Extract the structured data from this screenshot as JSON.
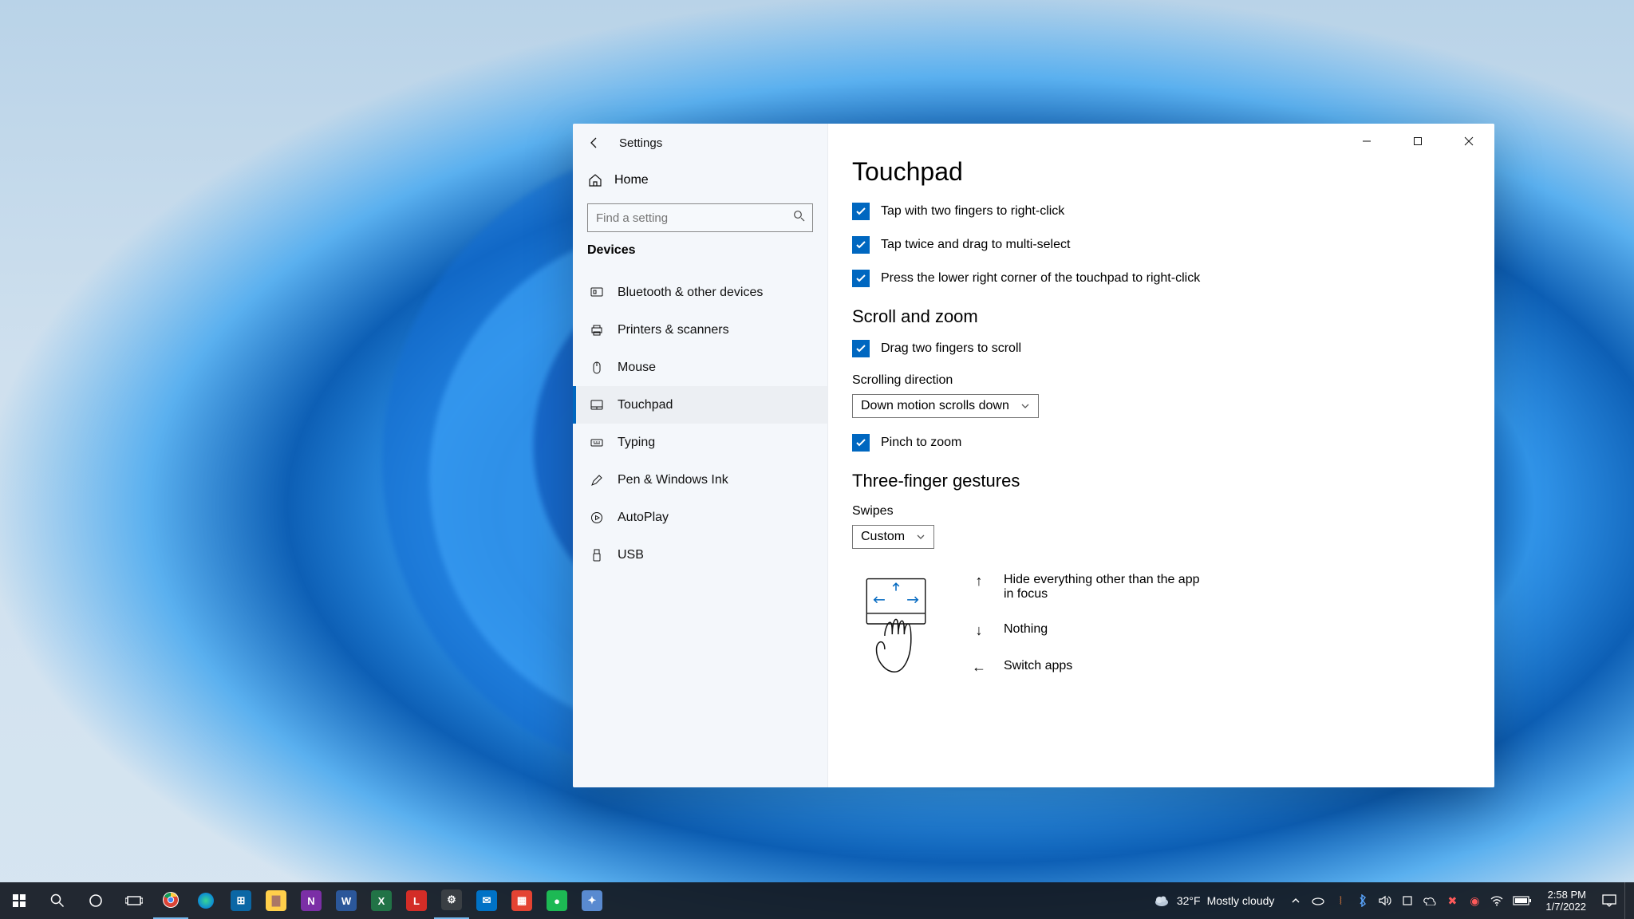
{
  "window": {
    "title": "Settings",
    "home": "Home",
    "search_placeholder": "Find a setting",
    "category": "Devices"
  },
  "sidebar": {
    "items": [
      {
        "label": "Bluetooth & other devices"
      },
      {
        "label": "Printers & scanners"
      },
      {
        "label": "Mouse"
      },
      {
        "label": "Touchpad"
      },
      {
        "label": "Typing"
      },
      {
        "label": "Pen & Windows Ink"
      },
      {
        "label": "AutoPlay"
      },
      {
        "label": "USB"
      }
    ]
  },
  "page": {
    "title": "Touchpad",
    "taps": [
      "Tap with two fingers to right-click",
      "Tap twice and drag to multi-select",
      "Press the lower right corner of the touchpad to right-click"
    ],
    "scroll_zoom_h": "Scroll and zoom",
    "drag_two": "Drag two fingers to scroll",
    "scroll_dir_label": "Scrolling direction",
    "scroll_dir_value": "Down motion scrolls down",
    "pinch": "Pinch to zoom",
    "three_h": "Three-finger gestures",
    "swipes_label": "Swipes",
    "swipes_value": "Custom",
    "gestures": {
      "up": "Hide everything other than the app in focus",
      "down": "Nothing",
      "left": "Switch apps"
    }
  },
  "taskbar": {
    "weather_temp": "32°F",
    "weather_text": "Mostly cloudy",
    "time": "2:58 PM",
    "date": "1/7/2022",
    "apps": [
      {
        "name": "chrome",
        "bg": "#fff",
        "fg": "#db4437",
        "letter": "◎"
      },
      {
        "name": "edge",
        "bg": "#0b8ad6",
        "fg": "#0b8",
        "letter": ""
      },
      {
        "name": "store",
        "bg": "#0b67a5",
        "fg": "#fff",
        "letter": "⊞"
      },
      {
        "name": "explorer",
        "bg": "#ffcf4b",
        "fg": "#a76",
        "letter": "▇"
      },
      {
        "name": "onenote",
        "bg": "#7b2fa6",
        "fg": "#fff",
        "letter": "N"
      },
      {
        "name": "word",
        "bg": "#2b579a",
        "fg": "#fff",
        "letter": "W"
      },
      {
        "name": "excel",
        "bg": "#217346",
        "fg": "#fff",
        "letter": "X"
      },
      {
        "name": "lastpass",
        "bg": "#d32d27",
        "fg": "#fff",
        "letter": "L"
      },
      {
        "name": "settings",
        "bg": "#3a3f44",
        "fg": "#fff",
        "letter": "⚙"
      },
      {
        "name": "mail",
        "bg": "#0072c6",
        "fg": "#fff",
        "letter": "✉"
      },
      {
        "name": "todoist",
        "bg": "#e44332",
        "fg": "#fff",
        "letter": "▦"
      },
      {
        "name": "spotify",
        "bg": "#1db954",
        "fg": "#fff",
        "letter": "●"
      },
      {
        "name": "teams",
        "bg": "#598ad0",
        "fg": "#fff",
        "letter": "✦"
      }
    ]
  }
}
